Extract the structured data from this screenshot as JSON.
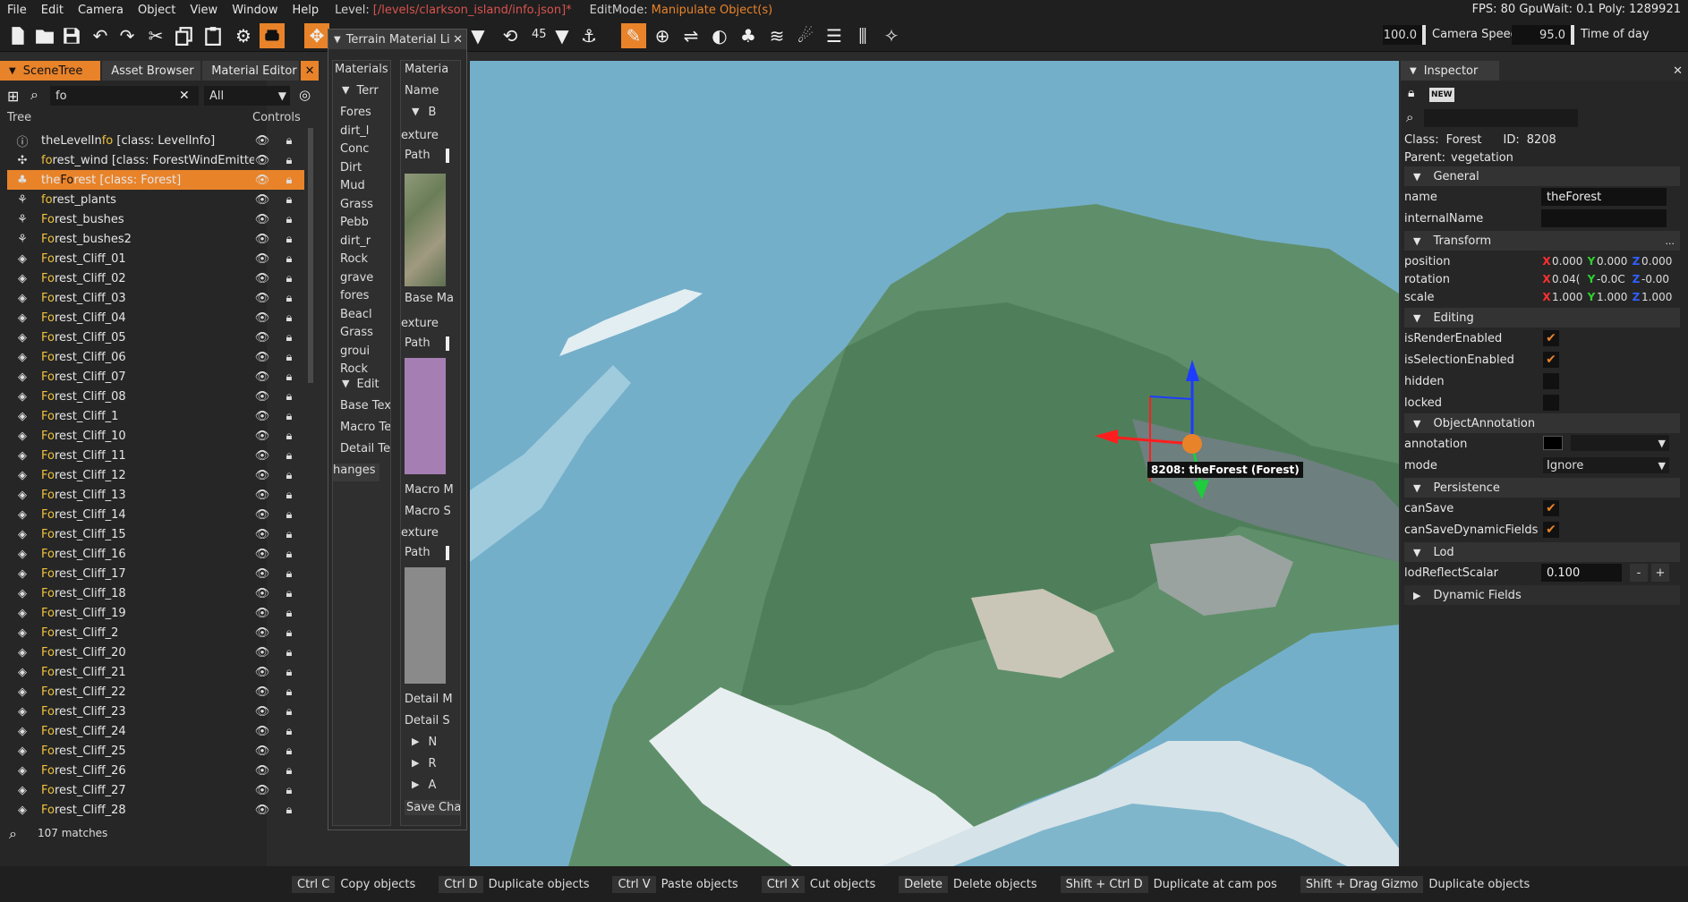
{
  "menubar": {
    "items": [
      "File",
      "Edit",
      "Camera",
      "Object",
      "View",
      "Window",
      "Help"
    ],
    "level_label": "Level:",
    "level_path": "[/levels/clarkson_island/info.json]*",
    "editmode_label": "EditMode:",
    "editmode_value": "Manipulate Object(s)",
    "stats": "FPS: 80  GpuWait: 0.1  Poly: 1289921"
  },
  "toolbar": {
    "angle_value": "45",
    "camera_speed_value": "100.0",
    "camera_speed_label": "Camera Speed",
    "time_value": "95.0",
    "time_label": "Time of day"
  },
  "scene": {
    "tabs": [
      "SceneTree",
      "Asset Browser",
      "Material Editor"
    ],
    "search_value": "fo",
    "filter_value": "All",
    "col_tree": "Tree",
    "col_controls": "Controls",
    "rows": [
      {
        "pre": "theLevelIn",
        "hl": "fo",
        "post": " [class: LevelInfo]",
        "icon": "info-icon"
      },
      {
        "pre": "",
        "hl": "fo",
        "post": "rest_wind [class: ForestWindEmitter]",
        "icon": "wind-icon"
      },
      {
        "pre": "the",
        "hl": "Fo",
        "post": "rest [class: Forest]",
        "icon": "forest-icon",
        "selected": true
      },
      {
        "pre": "",
        "hl": "fo",
        "post": "rest_plants",
        "icon": "plant-icon"
      },
      {
        "pre": "",
        "hl": "Fo",
        "post": "rest_bushes",
        "icon": "plant-icon"
      },
      {
        "pre": "",
        "hl": "Fo",
        "post": "rest_bushes2",
        "icon": "plant-icon"
      },
      {
        "pre": "",
        "hl": "Fo",
        "post": "rest_Cliff_01",
        "icon": "sound-icon"
      },
      {
        "pre": "",
        "hl": "Fo",
        "post": "rest_Cliff_02",
        "icon": "sound-icon"
      },
      {
        "pre": "",
        "hl": "Fo",
        "post": "rest_Cliff_03",
        "icon": "sound-icon"
      },
      {
        "pre": "",
        "hl": "Fo",
        "post": "rest_Cliff_04",
        "icon": "sound-icon"
      },
      {
        "pre": "",
        "hl": "Fo",
        "post": "rest_Cliff_05",
        "icon": "sound-icon"
      },
      {
        "pre": "",
        "hl": "Fo",
        "post": "rest_Cliff_06",
        "icon": "sound-icon"
      },
      {
        "pre": "",
        "hl": "Fo",
        "post": "rest_Cliff_07",
        "icon": "sound-icon"
      },
      {
        "pre": "",
        "hl": "Fo",
        "post": "rest_Cliff_08",
        "icon": "sound-icon"
      },
      {
        "pre": "",
        "hl": "Fo",
        "post": "rest_Cliff_1",
        "icon": "sound-icon"
      },
      {
        "pre": "",
        "hl": "Fo",
        "post": "rest_Cliff_10",
        "icon": "sound-icon"
      },
      {
        "pre": "",
        "hl": "Fo",
        "post": "rest_Cliff_11",
        "icon": "sound-icon"
      },
      {
        "pre": "",
        "hl": "Fo",
        "post": "rest_Cliff_12",
        "icon": "sound-icon"
      },
      {
        "pre": "",
        "hl": "Fo",
        "post": "rest_Cliff_13",
        "icon": "sound-icon"
      },
      {
        "pre": "",
        "hl": "Fo",
        "post": "rest_Cliff_14",
        "icon": "sound-icon"
      },
      {
        "pre": "",
        "hl": "Fo",
        "post": "rest_Cliff_15",
        "icon": "sound-icon"
      },
      {
        "pre": "",
        "hl": "Fo",
        "post": "rest_Cliff_16",
        "icon": "sound-icon"
      },
      {
        "pre": "",
        "hl": "Fo",
        "post": "rest_Cliff_17",
        "icon": "sound-icon"
      },
      {
        "pre": "",
        "hl": "Fo",
        "post": "rest_Cliff_18",
        "icon": "sound-icon"
      },
      {
        "pre": "",
        "hl": "Fo",
        "post": "rest_Cliff_19",
        "icon": "sound-icon"
      },
      {
        "pre": "",
        "hl": "Fo",
        "post": "rest_Cliff_2",
        "icon": "sound-icon"
      },
      {
        "pre": "",
        "hl": "Fo",
        "post": "rest_Cliff_20",
        "icon": "sound-icon"
      },
      {
        "pre": "",
        "hl": "Fo",
        "post": "rest_Cliff_21",
        "icon": "sound-icon"
      },
      {
        "pre": "",
        "hl": "Fo",
        "post": "rest_Cliff_22",
        "icon": "sound-icon"
      },
      {
        "pre": "",
        "hl": "Fo",
        "post": "rest_Cliff_23",
        "icon": "sound-icon"
      },
      {
        "pre": "",
        "hl": "Fo",
        "post": "rest_Cliff_24",
        "icon": "sound-icon"
      },
      {
        "pre": "",
        "hl": "Fo",
        "post": "rest_Cliff_25",
        "icon": "sound-icon"
      },
      {
        "pre": "",
        "hl": "Fo",
        "post": "rest_Cliff_26",
        "icon": "sound-icon"
      },
      {
        "pre": "",
        "hl": "Fo",
        "post": "rest_Cliff_27",
        "icon": "sound-icon"
      },
      {
        "pre": "",
        "hl": "Fo",
        "post": "rest_Cliff_28",
        "icon": "sound-icon"
      }
    ],
    "matches": "107 matches"
  },
  "terrain": {
    "title": "Terrain Material Li",
    "list_header": "Materials L",
    "tree_root": "Terr",
    "materials": [
      "Fores",
      "dirt_l",
      "Conc",
      "Dirt",
      "Mud",
      "Grass",
      "Pebb",
      "dirt_r",
      "Rock",
      "grave",
      "fores",
      "Beacl",
      "Grass",
      "groui",
      "Rock"
    ],
    "edit_group": "Edit",
    "edit_items": [
      "Base Text",
      "Macro Te:",
      "Detail Tex"
    ],
    "changes": "hanges",
    "props_header": "Materia",
    "name_label": "Name",
    "group_b": "B",
    "texture_label": "exture",
    "path_label": "Path",
    "base_map": "Base Ma",
    "macro_m": "Macro M",
    "macro_s": "Macro S",
    "detail_m": "Detail M",
    "detail_s": "Detail S",
    "collapsed": [
      "N",
      "R",
      "A"
    ],
    "save": "Save Chang"
  },
  "viewport": {
    "label": "8208: theForest (Forest)"
  },
  "inspector": {
    "title": "Inspector",
    "class_label": "Class:",
    "class_value": "Forest",
    "id_label": "ID:",
    "id_value": "8208",
    "parent_label": "Parent:",
    "parent_value": "vegetation",
    "sections": {
      "general": "General",
      "transform": "Transform",
      "editing": "Editing",
      "annotation": "ObjectAnnotation",
      "persistence": "Persistence",
      "lod": "Lod",
      "dynamic": "Dynamic Fields"
    },
    "name_label": "name",
    "name_value": "theForest",
    "internal_label": "internalName",
    "internal_value": "",
    "position_label": "position",
    "position": [
      "0.000",
      "0.000",
      "0.000"
    ],
    "rotation_label": "rotation",
    "rotation": [
      "0.04(",
      "-0.0C",
      "-0.00"
    ],
    "scale_label": "scale",
    "scale": [
      "1.000",
      "1.000",
      "1.000"
    ],
    "render_label": "isRenderEnabled",
    "selection_label": "isSelectionEnabled",
    "hidden_label": "hidden",
    "locked_label": "locked",
    "annotation_label": "annotation",
    "mode_label": "mode",
    "mode_value": "Ignore",
    "cansave_label": "canSave",
    "cansavedyn_label": "canSaveDynamicFields",
    "lod_label": "lodReflectScalar",
    "lod_value": "0.100",
    "dots": "...",
    "minus": "-",
    "plus": "+",
    "new_badge": "NEW"
  },
  "statusbar": {
    "shortcuts": [
      {
        "key": "Ctrl C",
        "action": "Copy objects"
      },
      {
        "key": "Ctrl D",
        "action": "Duplicate objects"
      },
      {
        "key": "Ctrl V",
        "action": "Paste objects"
      },
      {
        "key": "Ctrl X",
        "action": "Cut objects"
      },
      {
        "key": "Delete",
        "action": "Delete objects"
      },
      {
        "key": "Shift + Ctrl D",
        "action": "Duplicate at cam pos"
      },
      {
        "key": "Shift + Drag Gizmo",
        "action": "Duplicate objects"
      }
    ]
  },
  "colors": {
    "accent": "#e8832a",
    "highlight": "#f0c23b"
  }
}
